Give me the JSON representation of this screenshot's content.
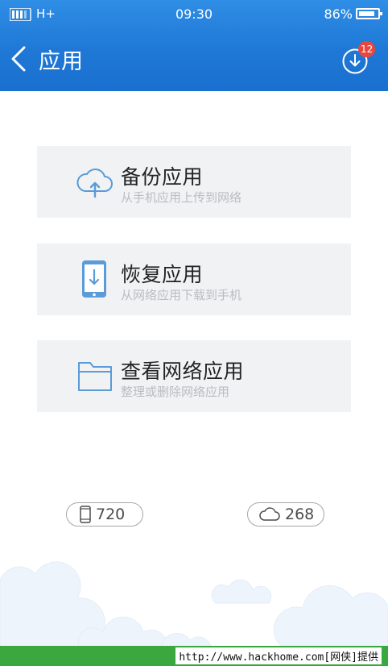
{
  "status_bar": {
    "network": "H+",
    "time": "09:30",
    "battery": "86%",
    "battery_level": 0.86,
    "icons": [
      "signal-icon",
      "battery-icon"
    ]
  },
  "action_bar": {
    "title": "应用",
    "back_icon": "chevron-left-icon",
    "download_icon": "download-circle-icon",
    "download_badge": "12"
  },
  "cards": [
    {
      "title": "备份应用",
      "subtitle": "从手机应用上传到网络",
      "icon": "cloud-upload-icon"
    },
    {
      "title": "恢复应用",
      "subtitle": "从网络应用下载到手机",
      "icon": "phone-download-icon"
    },
    {
      "title": "查看网络应用",
      "subtitle": "整理或删除网络应用",
      "icon": "folder-icon"
    }
  ],
  "counts": {
    "phone": {
      "icon": "phone-icon",
      "value": "720"
    },
    "cloud": {
      "icon": "cloud-icon",
      "value": "268"
    }
  },
  "footer": {
    "caption": "http://www.hackhome.com[网侠]提供"
  },
  "colors": {
    "header_blue": "#1f78d6",
    "card_bg": "#f1f2f4",
    "icon_blue": "#5a9bd8",
    "badge_red": "#e8473f",
    "footer_green": "#3aa83f"
  }
}
